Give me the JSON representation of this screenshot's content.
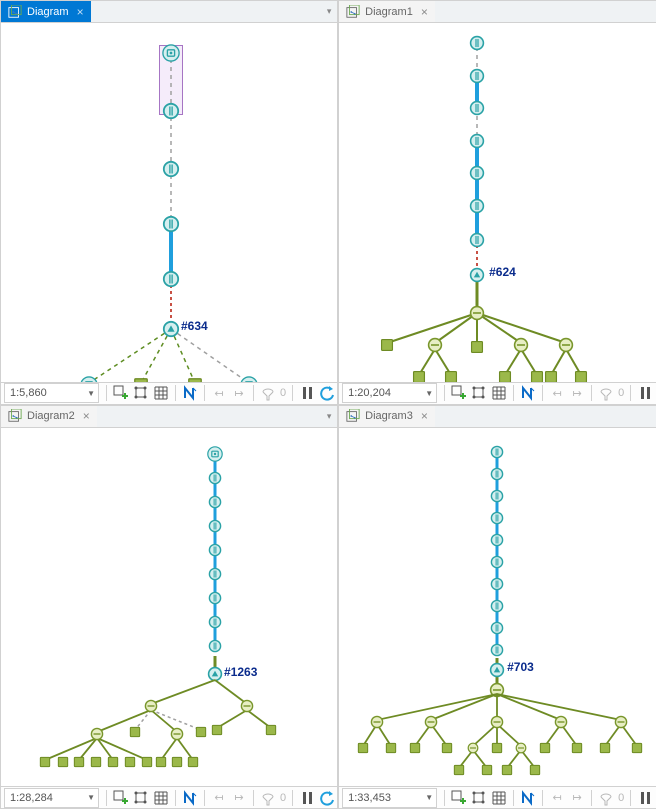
{
  "panes": [
    {
      "id": "diag0",
      "tab": {
        "label": "Diagram",
        "active": true
      },
      "scale": "1:5,860",
      "annotation": "#634",
      "count": "0"
    },
    {
      "id": "diag1",
      "tab": {
        "label": "Diagram1",
        "active": false
      },
      "scale": "1:20,204",
      "annotation": "#624",
      "count": "0"
    },
    {
      "id": "diag2",
      "tab": {
        "label": "Diagram2",
        "active": false
      },
      "scale": "1:28,284",
      "annotation": "#1263",
      "count": "0"
    },
    {
      "id": "diag3",
      "tab": {
        "label": "Diagram3",
        "active": false
      },
      "scale": "1:33,453",
      "annotation": "#703",
      "count": "0"
    }
  ],
  "icons": {
    "diagram_tab": "diagram-icon",
    "toolbar": [
      "add-features-icon",
      "align-vertices-icon",
      "grid-icon",
      "numeric-n-icon",
      "step-back-icon",
      "step-fwd-icon",
      "filter-icon",
      "pause-icon",
      "refresh-icon"
    ]
  },
  "colors": {
    "active_tab": "#0078d4",
    "annotation_text": "#0a2b8c",
    "node_teal": "#2aa2a6",
    "node_olive": "#79962c",
    "line_grey": "#a0a0a0",
    "line_red_dash": "#c85145",
    "line_green_dash": "#5e8d22",
    "line_blue_solid": "#1f9fdd"
  }
}
